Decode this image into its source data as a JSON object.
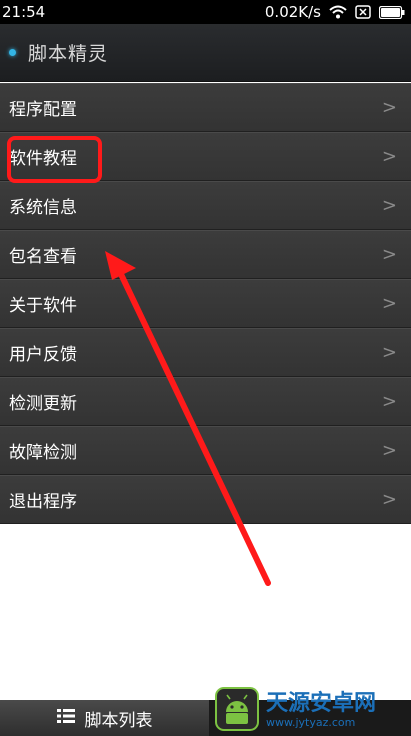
{
  "status_bar": {
    "time": "21:54",
    "network_speed": "0.02K/s"
  },
  "title_bar": {
    "title": "脚本精灵"
  },
  "menu": {
    "items": [
      {
        "label": "程序配置"
      },
      {
        "label": "软件教程"
      },
      {
        "label": "系统信息"
      },
      {
        "label": "包名查看"
      },
      {
        "label": "关于软件"
      },
      {
        "label": "用户反馈"
      },
      {
        "label": "检测更新"
      },
      {
        "label": "故障检测"
      },
      {
        "label": "退出程序"
      }
    ],
    "chevron": ">"
  },
  "bottom_bar": {
    "tab_label": "脚本列表"
  },
  "watermark": {
    "name": "天源安卓网",
    "url": "www.jytyaz.com"
  },
  "colors": {
    "annotation_red": "#ff1a1a",
    "accent_blue": "#33b5e5",
    "watermark_blue": "#1b6fb8"
  },
  "icons": [
    "wifi-icon",
    "sim-x-icon",
    "battery-icon",
    "list-icon",
    "android-logo-icon",
    "chevron-right-icon"
  ]
}
